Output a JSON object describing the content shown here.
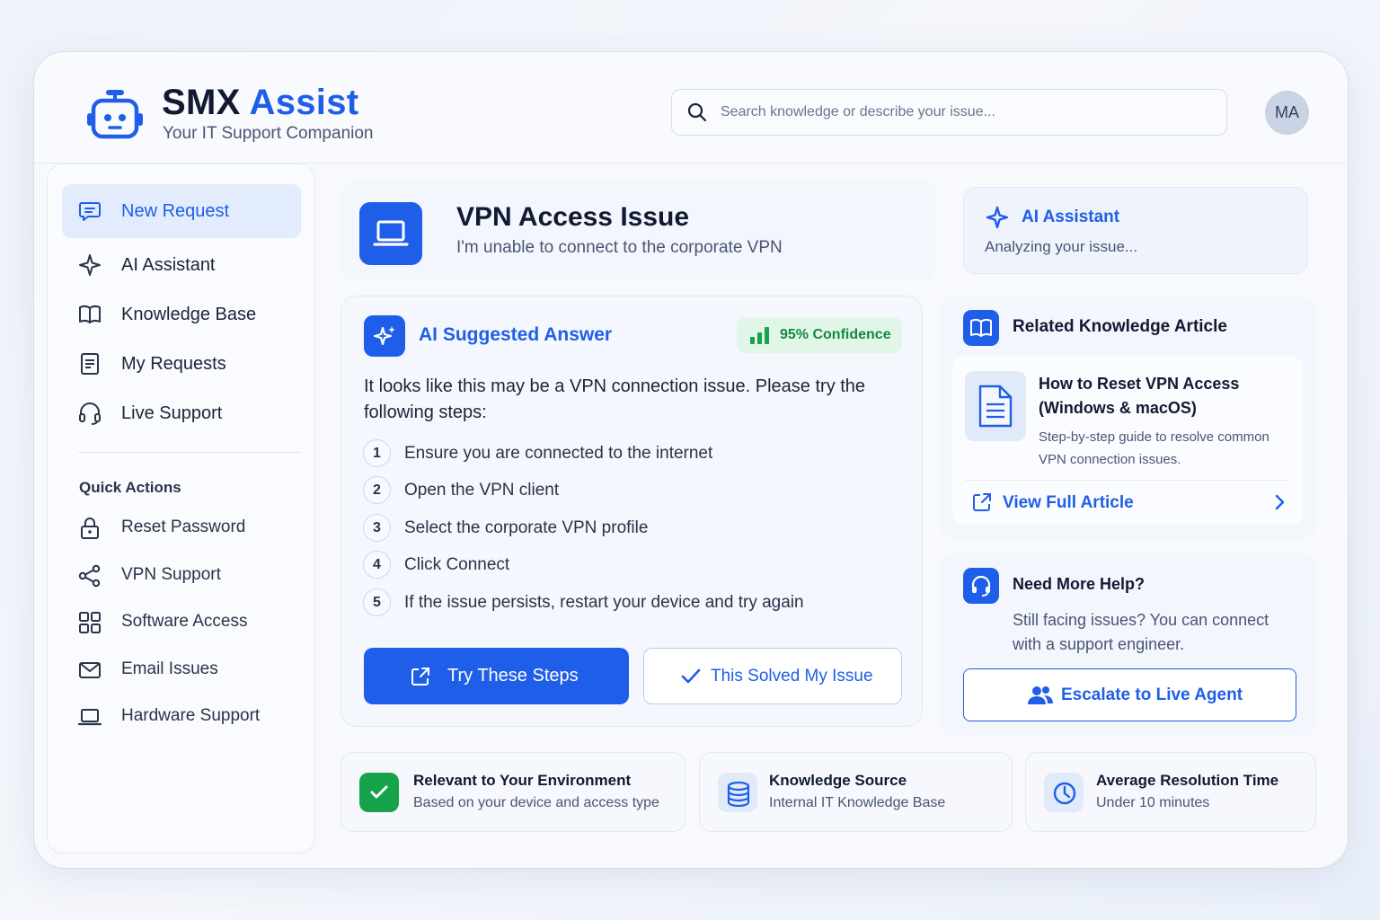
{
  "header": {
    "brand_main": "SMX",
    "brand_accent": "Assist",
    "tagline": "Your IT Support Companion",
    "search_placeholder": "Search knowledge or describe your issue...",
    "avatar_initials": "MA"
  },
  "sidebar": {
    "nav": [
      {
        "label": "New Request",
        "icon": "chat-icon",
        "active": true
      },
      {
        "label": "AI Assistant",
        "icon": "sparkle-icon"
      },
      {
        "label": "Knowledge Base",
        "icon": "book-icon"
      },
      {
        "label": "My Requests",
        "icon": "document-icon"
      },
      {
        "label": "Live Support",
        "icon": "headset-icon"
      }
    ],
    "quick_actions_title": "Quick Actions",
    "quick_actions": [
      {
        "label": "Reset Password",
        "icon": "lock-icon"
      },
      {
        "label": "VPN Support",
        "icon": "share-icon"
      },
      {
        "label": "Software Access",
        "icon": "grid-icon"
      },
      {
        "label": "Email Issues",
        "icon": "mail-icon"
      },
      {
        "label": "Hardware Support",
        "icon": "laptop-icon"
      }
    ]
  },
  "issue": {
    "title": "VPN Access Issue",
    "subtitle": "I'm unable to connect to the corporate VPN"
  },
  "ai_status": {
    "title": "AI Assistant",
    "status": "Analyzing your issue..."
  },
  "answer": {
    "title": "AI Suggested Answer",
    "confidence": "95% Confidence",
    "intro": "It looks like this may be a VPN connection issue. Please try the following steps:",
    "steps": [
      {
        "num": "1",
        "text": "Ensure you are connected to the internet"
      },
      {
        "num": "2",
        "text": "Open the VPN client"
      },
      {
        "num": "3",
        "text": "Select the corporate VPN profile"
      },
      {
        "num": "4",
        "text": "Click Connect"
      },
      {
        "num": "5",
        "text": "If the issue persists, restart your device and try again"
      }
    ],
    "primary_button": "Try These Steps",
    "secondary_button": "This Solved My Issue"
  },
  "knowledge": {
    "title": "Related Knowledge Article",
    "article_title": "How to Reset VPN Access (Windows & macOS)",
    "article_desc": "Step-by-step guide to resolve common VPN connection issues.",
    "link_label": "View Full Article"
  },
  "help": {
    "title": "Need More Help?",
    "text": "Still facing issues? You can connect with a support engineer.",
    "button": "Escalate to Live Agent"
  },
  "info_cards": [
    {
      "title": "Relevant to Your Environment",
      "sub": "Based on your device and access type",
      "icon": "check-icon"
    },
    {
      "title": "Knowledge Source",
      "sub": "Internal IT Knowledge Base",
      "icon": "database-icon"
    },
    {
      "title": "Average Resolution Time",
      "sub": "Under 10 minutes",
      "icon": "clock-icon"
    }
  ],
  "colors": {
    "accent": "#1f5ee8",
    "success": "#16a34a",
    "background": "#f7f9fd"
  }
}
